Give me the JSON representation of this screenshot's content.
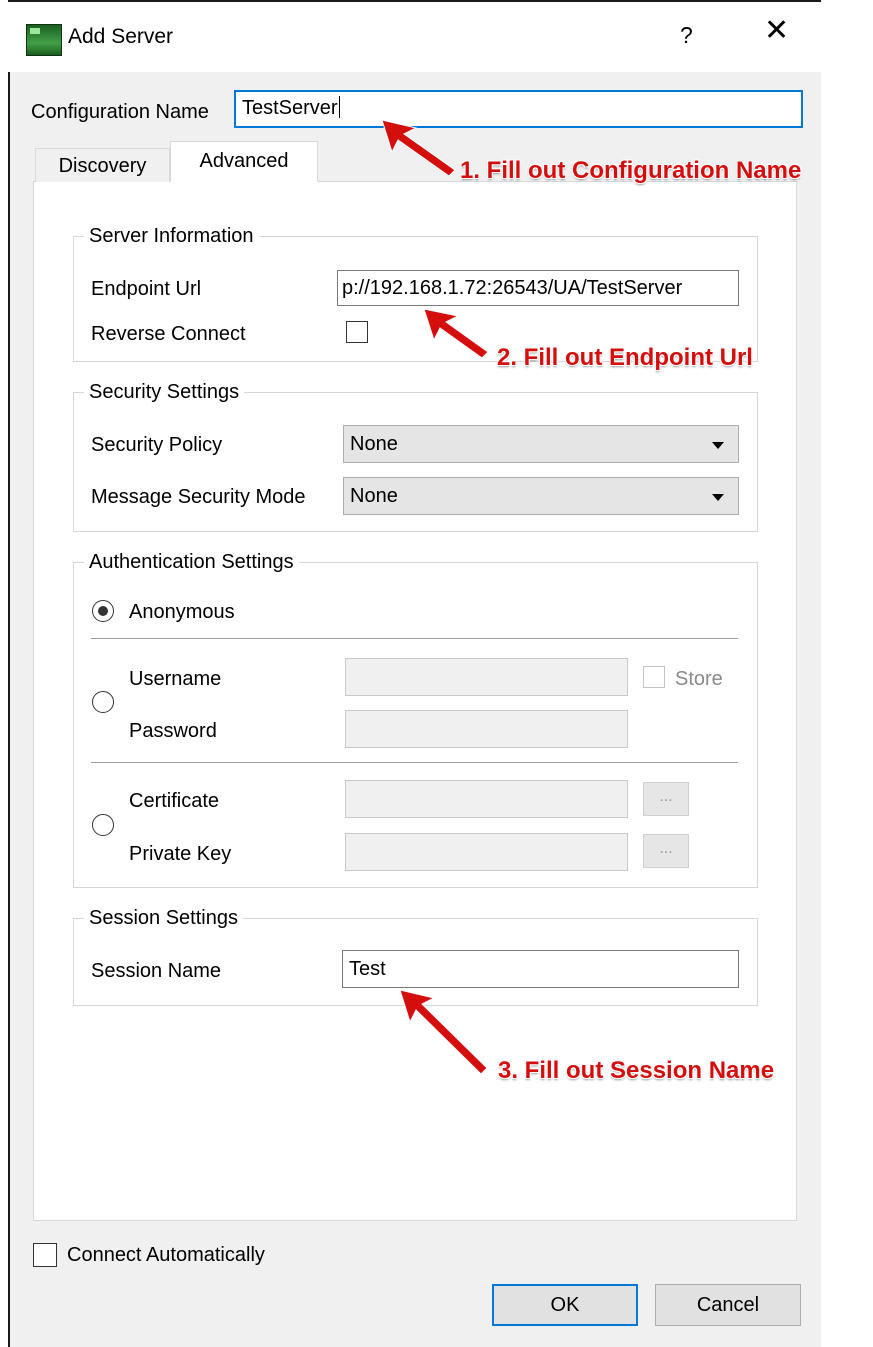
{
  "window": {
    "title": "Add Server",
    "help_label": "?",
    "close_label": "✕"
  },
  "config": {
    "label": "Configuration Name",
    "value": "TestServer"
  },
  "tabs": [
    {
      "label": "Discovery"
    },
    {
      "label": "Advanced"
    }
  ],
  "server_info": {
    "title": "Server Information",
    "endpoint_label": "Endpoint Url",
    "endpoint_value": "p://192.168.1.72:26543/UA/TestServer",
    "reverse_label": "Reverse Connect"
  },
  "security": {
    "title": "Security Settings",
    "policy_label": "Security Policy",
    "policy_value": "None",
    "mode_label": "Message Security Mode",
    "mode_value": "None"
  },
  "auth": {
    "title": "Authentication Settings",
    "anonymous_label": "Anonymous",
    "username_label": "Username",
    "password_label": "Password",
    "store_label": "Store",
    "certificate_label": "Certificate",
    "private_key_label": "Private Key",
    "browse_label": "..."
  },
  "session": {
    "title": "Session Settings",
    "name_label": "Session Name",
    "name_value": "Test"
  },
  "footer": {
    "connect_auto_label": "Connect Automatically",
    "ok_label": "OK",
    "cancel_label": "Cancel"
  },
  "annotations": [
    "1. Fill out Configuration Name",
    "2. Fill out Endpoint Url",
    "3. Fill out Session Name"
  ],
  "colors": {
    "annotation": "#d40d0d",
    "focus_border": "#0078d7",
    "app_icon": "#2e7d32"
  }
}
